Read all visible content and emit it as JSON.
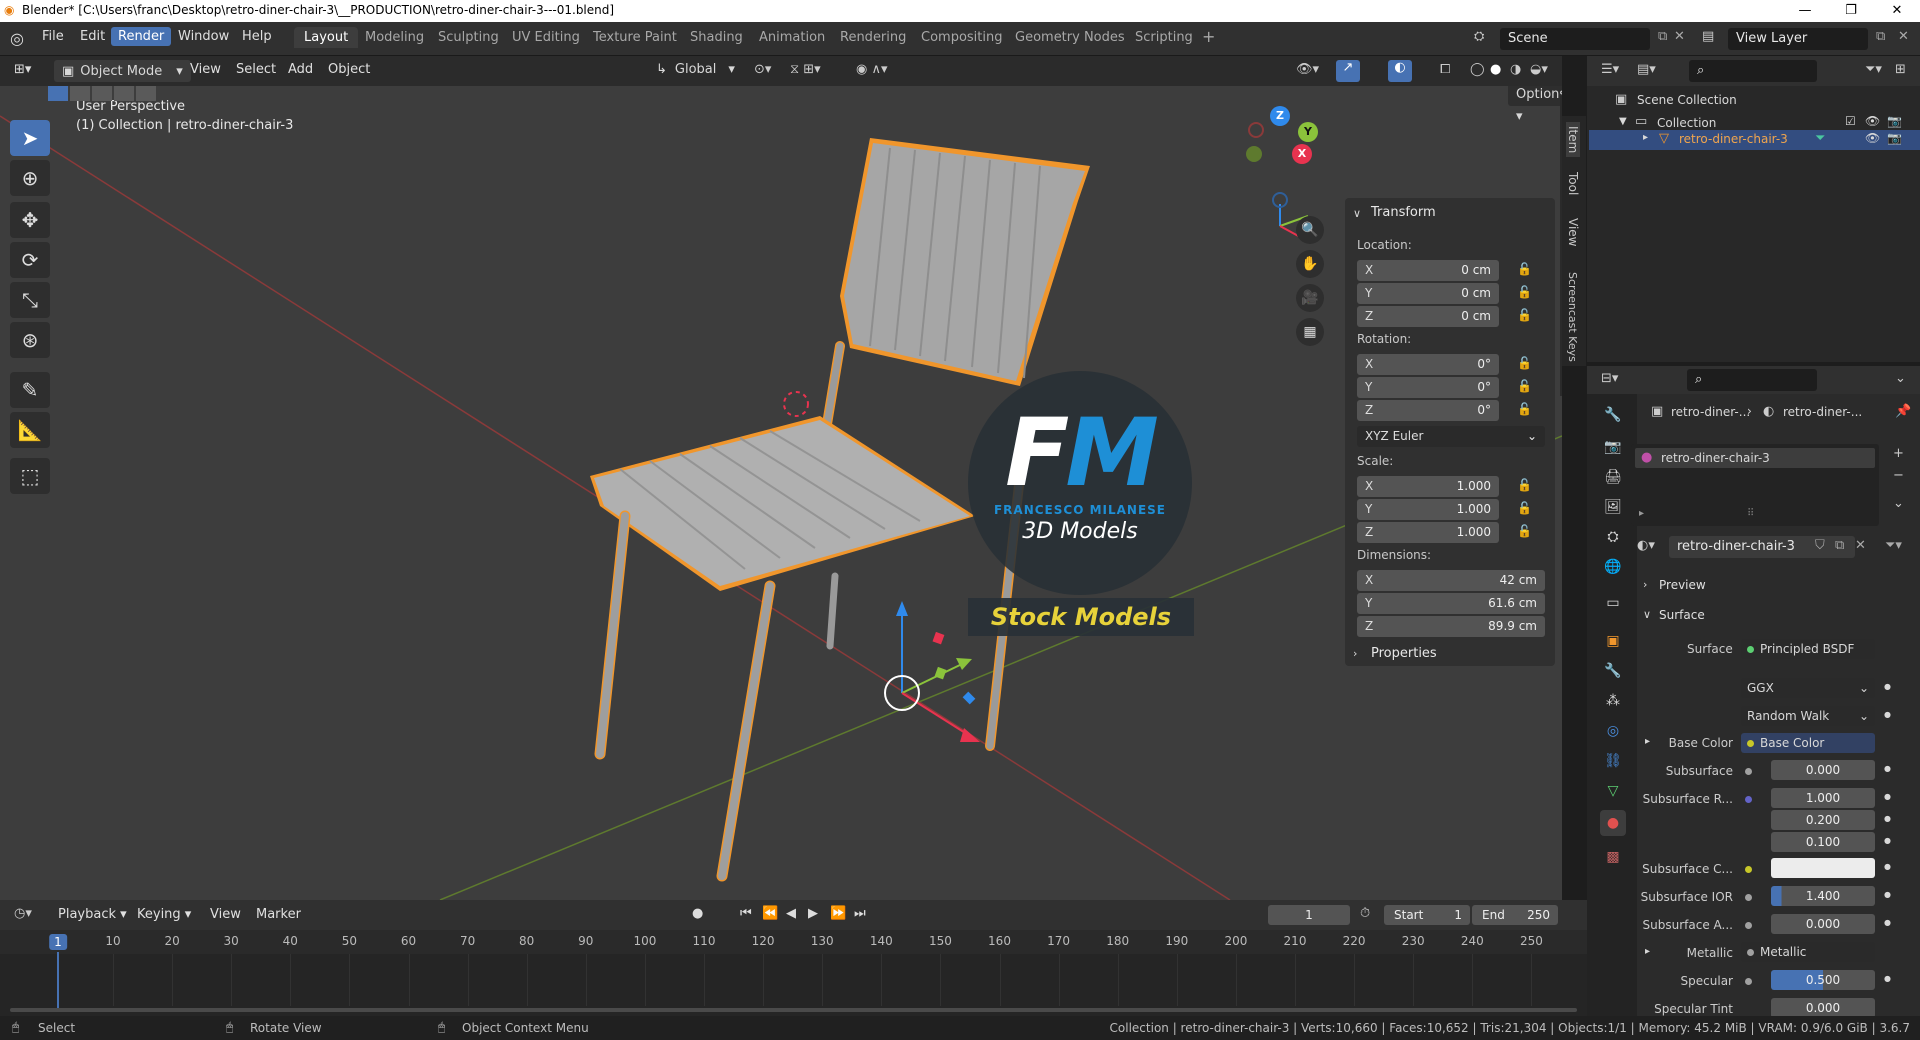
{
  "window": {
    "title": "Blender* [C:\\Users\\franc\\Desktop\\retro-diner-chair-3\\__PRODUCTION\\retro-diner-chair-3---01.blend]",
    "minimize": "—",
    "maximize": "❐",
    "close": "✕"
  },
  "menus": [
    "File",
    "Edit",
    "Render",
    "Window",
    "Help"
  ],
  "active_menu": "Render",
  "workspaces": [
    "Layout",
    "Modeling",
    "Sculpting",
    "UV Editing",
    "Texture Paint",
    "Shading",
    "Animation",
    "Rendering",
    "Compositing",
    "Geometry Nodes",
    "Scripting"
  ],
  "add_workspace": "+",
  "scene": {
    "label": "Scene",
    "view_layer": "View Layer"
  },
  "viewport_header": {
    "mode": "Object Mode",
    "menus": [
      "View",
      "Select",
      "Add",
      "Object"
    ],
    "orientation": "Global",
    "options": "Options"
  },
  "viewport": {
    "perspective": "User Perspective",
    "collection_info": "(1) Collection | retro-diner-chair-3",
    "gizmo_axes": {
      "x": "X",
      "y": "Y",
      "z": "Z"
    },
    "colors": {
      "x": "#e8334f",
      "y": "#8bc33b",
      "z": "#2f8aec",
      "selection": "#f0962c"
    }
  },
  "watermark": {
    "logo": "FM",
    "name": "FRANCESCO MILANESE",
    "subtitle": "3D Models",
    "banner": "Stock Models"
  },
  "npanel": {
    "tabs": [
      "Item",
      "Tool",
      "View",
      "Screencast Keys"
    ],
    "section": "Transform",
    "location_label": "Location:",
    "location": [
      {
        "axis": "X",
        "value": "0 cm"
      },
      {
        "axis": "Y",
        "value": "0 cm"
      },
      {
        "axis": "Z",
        "value": "0 cm"
      }
    ],
    "rotation_label": "Rotation:",
    "rotation": [
      {
        "axis": "X",
        "value": "0°"
      },
      {
        "axis": "Y",
        "value": "0°"
      },
      {
        "axis": "Z",
        "value": "0°"
      }
    ],
    "rotation_mode": "XYZ Euler",
    "scale_label": "Scale:",
    "scale": [
      {
        "axis": "X",
        "value": "1.000"
      },
      {
        "axis": "Y",
        "value": "1.000"
      },
      {
        "axis": "Z",
        "value": "1.000"
      }
    ],
    "dimensions_label": "Dimensions:",
    "dimensions": [
      {
        "axis": "X",
        "value": "42 cm"
      },
      {
        "axis": "Y",
        "value": "61.6 cm"
      },
      {
        "axis": "Z",
        "value": "89.9 cm"
      }
    ],
    "properties": "Properties"
  },
  "outliner": {
    "root": "Scene Collection",
    "collection": "Collection",
    "object": "retro-diner-chair-3"
  },
  "properties": {
    "breadcrumb": [
      "retro-diner-...",
      "retro-diner-..."
    ],
    "material_slot": "retro-diner-chair-3",
    "material_name": "retro-diner-chair-3",
    "sections": {
      "preview": "Preview",
      "surface": "Surface"
    },
    "surface_label": "Surface",
    "surface_shader": "Principled BSDF",
    "distribution": "GGX",
    "subsurface_method": "Random Walk",
    "rows": [
      {
        "label": "Base Color",
        "value": "Base Color",
        "kind": "link"
      },
      {
        "label": "Subsurface",
        "value": "0.000"
      },
      {
        "label": "Subsurface R...",
        "value": "1.000"
      },
      {
        "label": "",
        "value": "0.200"
      },
      {
        "label": "",
        "value": "0.100"
      },
      {
        "label": "Subsurface C...",
        "value": ""
      },
      {
        "label": "Subsurface IOR",
        "value": "1.400"
      },
      {
        "label": "Subsurface A...",
        "value": "0.000"
      },
      {
        "label": "Metallic",
        "value": "Metallic",
        "kind": "link"
      },
      {
        "label": "Specular",
        "value": "0.500"
      },
      {
        "label": "Specular Tint",
        "value": "0.000"
      }
    ]
  },
  "timeline": {
    "menus": [
      "Playback",
      "Keying",
      "View",
      "Marker"
    ],
    "current_frame": "1",
    "start_label": "Start",
    "start": "1",
    "end_label": "End",
    "end": "250",
    "ticks": [
      "1",
      "10",
      "20",
      "30",
      "40",
      "50",
      "60",
      "70",
      "80",
      "90",
      "100",
      "110",
      "120",
      "130",
      "140",
      "150",
      "160",
      "170",
      "180",
      "190",
      "200",
      "210",
      "220",
      "230",
      "240",
      "250"
    ]
  },
  "status": {
    "hints": [
      "Select",
      "Rotate View",
      "Object Context Menu"
    ],
    "info": "Collection | retro-diner-chair-3 | Verts:10,660 | Faces:10,652 | Tris:21,304 | Objects:1/1 | Memory: 45.2 MiB | VRAM: 0.9/6.0 GiB | 3.6.7"
  }
}
